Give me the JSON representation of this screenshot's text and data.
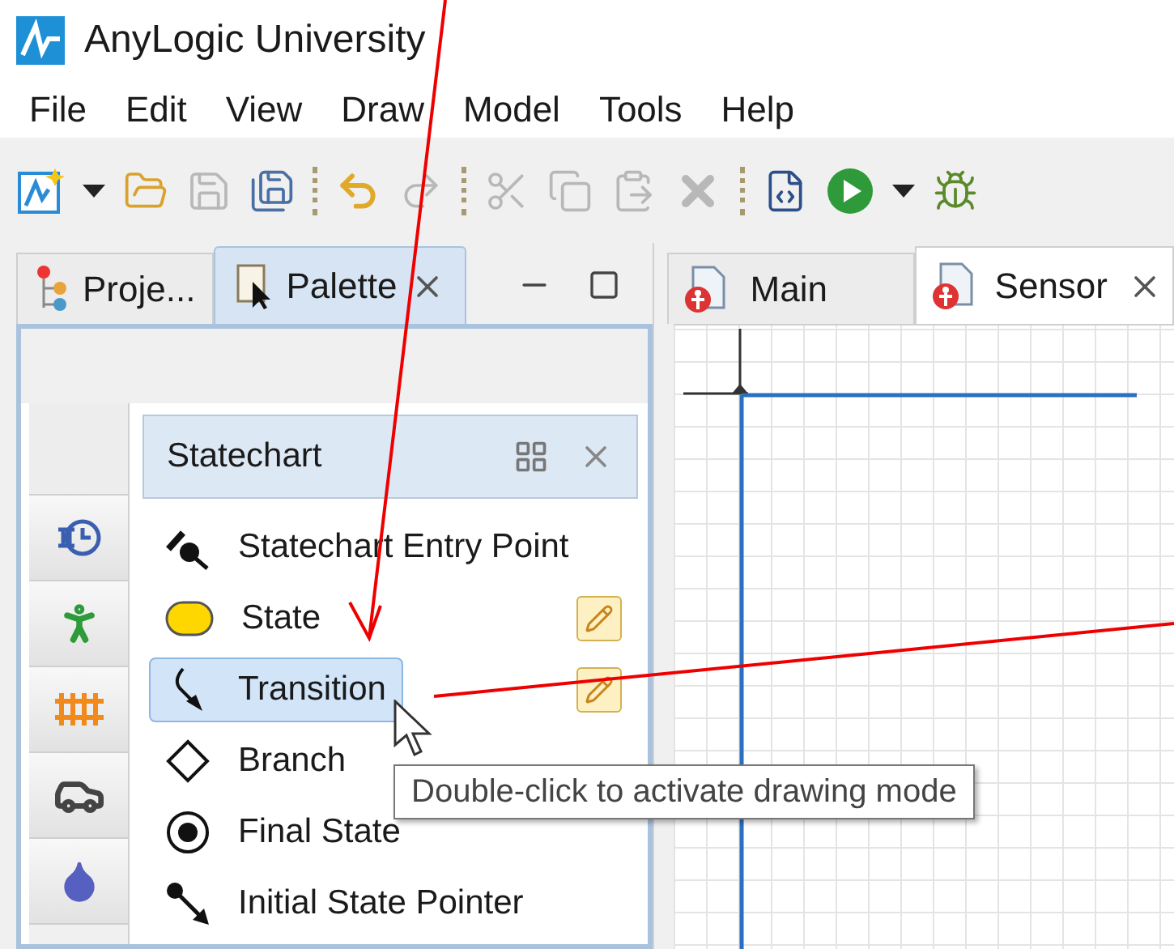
{
  "window": {
    "title": "AnyLogic University"
  },
  "menu": [
    "File",
    "Edit",
    "View",
    "Draw",
    "Model",
    "Tools",
    "Help"
  ],
  "toolbar": [
    {
      "kind": "new",
      "disabled": false
    },
    {
      "kind": "dropdown",
      "disabled": false
    },
    {
      "kind": "open",
      "disabled": false
    },
    {
      "kind": "save",
      "disabled": true
    },
    {
      "kind": "save_all",
      "disabled": false
    },
    {
      "kind": "separator"
    },
    {
      "kind": "undo",
      "disabled": false
    },
    {
      "kind": "redo",
      "disabled": true
    },
    {
      "kind": "separator"
    },
    {
      "kind": "cut",
      "disabled": true
    },
    {
      "kind": "copy",
      "disabled": true
    },
    {
      "kind": "paste",
      "disabled": true
    },
    {
      "kind": "delete",
      "disabled": true
    },
    {
      "kind": "separator"
    },
    {
      "kind": "build",
      "disabled": false
    },
    {
      "kind": "run",
      "disabled": false
    },
    {
      "kind": "dropdown",
      "disabled": false
    },
    {
      "kind": "debug",
      "disabled": false
    }
  ],
  "left_tabs": [
    {
      "label": "Proje...",
      "kind": "project",
      "selected": false
    },
    {
      "label": "Palette",
      "kind": "palette",
      "selected": true
    }
  ],
  "palette_categories": [
    {
      "kind": "blank",
      "selected": true
    },
    {
      "kind": "statechart",
      "selected": false
    },
    {
      "kind": "pedestrian",
      "selected": false
    },
    {
      "kind": "rail",
      "selected": false
    },
    {
      "kind": "road",
      "selected": false
    },
    {
      "kind": "fluid",
      "selected": false
    }
  ],
  "palette": {
    "title": "Statechart",
    "items": [
      {
        "label": "Statechart Entry Point",
        "kind": "entry",
        "selected": false,
        "editable": false
      },
      {
        "label": "State",
        "kind": "state",
        "selected": false,
        "editable": true
      },
      {
        "label": "Transition",
        "kind": "transition",
        "selected": true,
        "editable": true
      },
      {
        "label": "Branch",
        "kind": "branch",
        "selected": false,
        "editable": false
      },
      {
        "label": "Final State",
        "kind": "final",
        "selected": false,
        "editable": false
      },
      {
        "label": "Initial State Pointer",
        "kind": "pointer",
        "selected": false,
        "editable": false
      }
    ]
  },
  "tooltip": "Double-click to activate drawing mode",
  "editor_tabs": [
    {
      "label": "Main",
      "selected": false
    },
    {
      "label": "Sensor",
      "selected": true
    }
  ]
}
